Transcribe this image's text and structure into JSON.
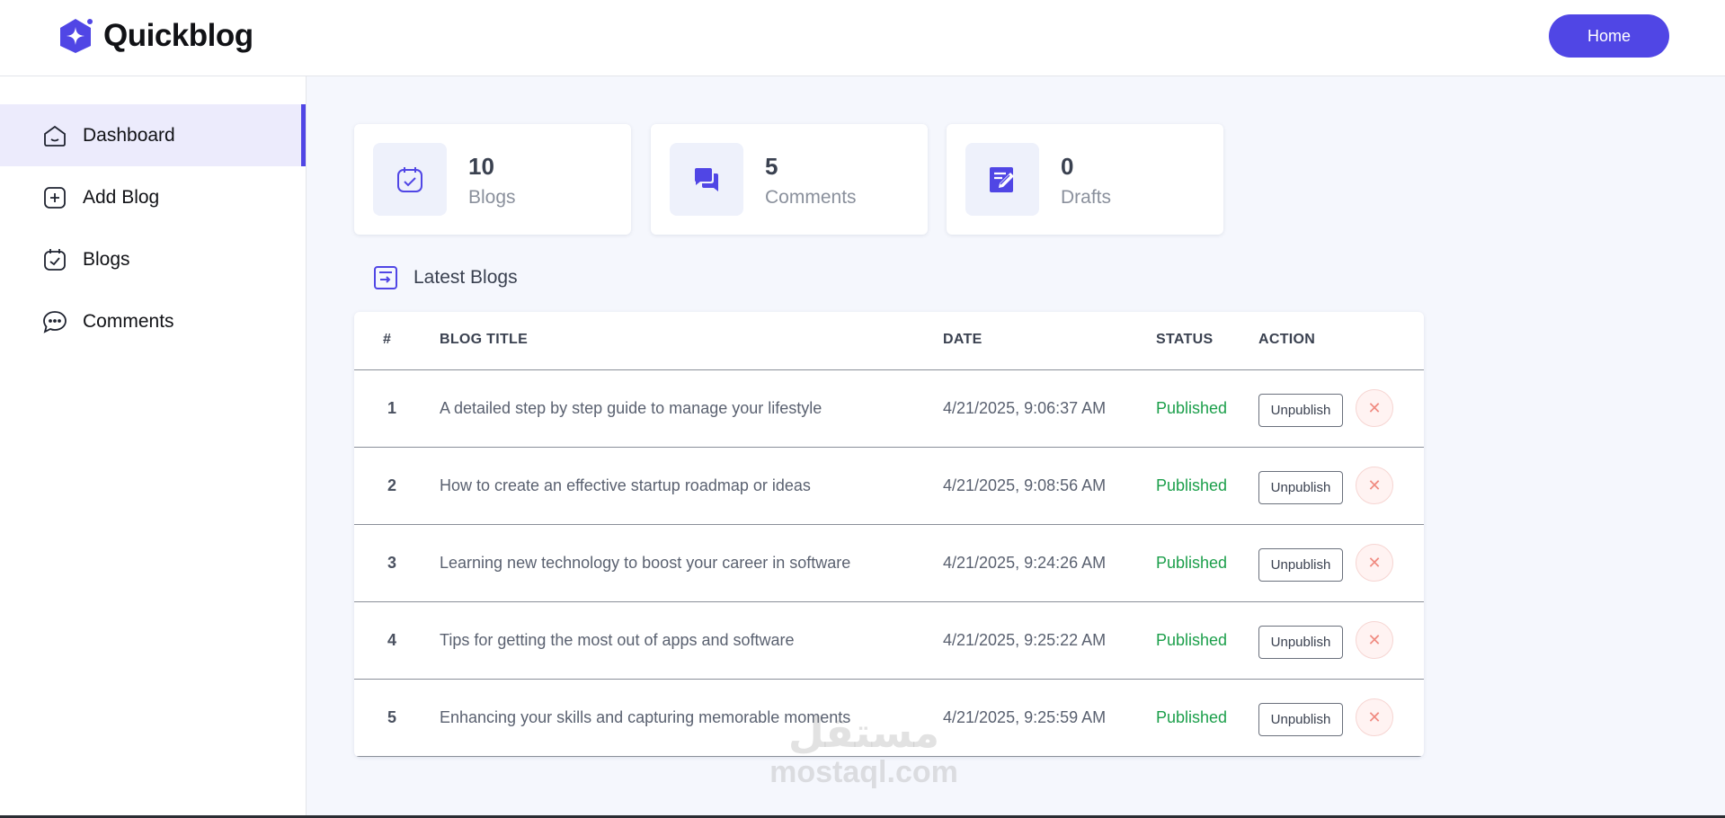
{
  "app": {
    "name": "Quickblog",
    "home_label": "Home"
  },
  "sidebar": {
    "items": [
      {
        "label": "Dashboard",
        "icon": "home-icon",
        "active": true
      },
      {
        "label": "Add Blog",
        "icon": "add-square-icon",
        "active": false
      },
      {
        "label": "Blogs",
        "icon": "blog-list-icon",
        "active": false
      },
      {
        "label": "Comments",
        "icon": "comment-icon",
        "active": false
      }
    ]
  },
  "stats": [
    {
      "value": "10",
      "label": "Blogs",
      "icon": "blog-icon"
    },
    {
      "value": "5",
      "label": "Comments",
      "icon": "comments-icon"
    },
    {
      "value": "0",
      "label": "Drafts",
      "icon": "drafts-icon"
    }
  ],
  "latest": {
    "title": "Latest Blogs",
    "columns": [
      "#",
      "BLOG TITLE",
      "DATE",
      "STATUS",
      "ACTION"
    ],
    "rows": [
      {
        "num": "1",
        "title": "A detailed step by step guide to manage your lifestyle",
        "date": "4/21/2025, 9:06:37 AM",
        "status": "Published",
        "action": "Unpublish"
      },
      {
        "num": "2",
        "title": "How to create an effective startup roadmap or ideas",
        "date": "4/21/2025, 9:08:56 AM",
        "status": "Published",
        "action": "Unpublish"
      },
      {
        "num": "3",
        "title": "Learning new technology to boost your career in software",
        "date": "4/21/2025, 9:24:26 AM",
        "status": "Published",
        "action": "Unpublish"
      },
      {
        "num": "4",
        "title": "Tips for getting the most out of apps and software",
        "date": "4/21/2025, 9:25:22 AM",
        "status": "Published",
        "action": "Unpublish"
      },
      {
        "num": "5",
        "title": "Enhancing your skills and capturing memorable moments",
        "date": "4/21/2025, 9:25:59 AM",
        "status": "Published",
        "action": "Unpublish"
      }
    ]
  },
  "colors": {
    "accent": "#5046e5",
    "published": "#1c9f4b",
    "delete": "#f08a80",
    "background": "#f5f7fd"
  },
  "watermark": {
    "arabic": "مستقل",
    "latin": "mostaql.com"
  }
}
